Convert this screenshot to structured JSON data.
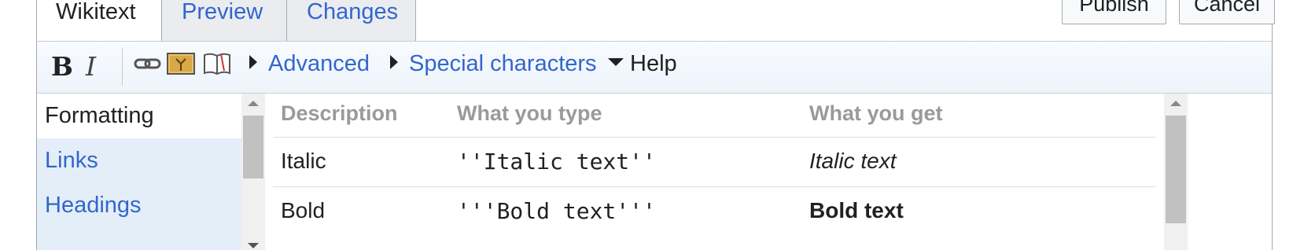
{
  "tabs": [
    {
      "label": "Wikitext"
    },
    {
      "label": "Preview"
    },
    {
      "label": "Changes"
    }
  ],
  "actions": {
    "publish_label": "Publish",
    "cancel_label": "Cancel"
  },
  "toolbar": {
    "bold_label": "B",
    "italic_label": "I",
    "icons": [
      "link-icon",
      "embedded-file-icon",
      "cite-book-icon"
    ],
    "groups": {
      "advanced": "Advanced",
      "special_characters": "Special characters",
      "help": "Help"
    }
  },
  "help": {
    "sections": [
      {
        "label": "Formatting",
        "active": true
      },
      {
        "label": "Links",
        "active": false
      },
      {
        "label": "Headings",
        "active": false
      }
    ],
    "table": {
      "headers": [
        "Description",
        "What you type",
        "What you get"
      ],
      "rows": [
        {
          "description": "Italic",
          "type": "''Italic text''",
          "get": "Italic text"
        },
        {
          "description": "Bold",
          "type": "'''Bold text'''",
          "get": "Bold text"
        }
      ]
    }
  },
  "colors": {
    "link": "#3366cc",
    "text": "#202122",
    "border": "#a2a9b1",
    "nav_bg": "#e4eef8"
  }
}
